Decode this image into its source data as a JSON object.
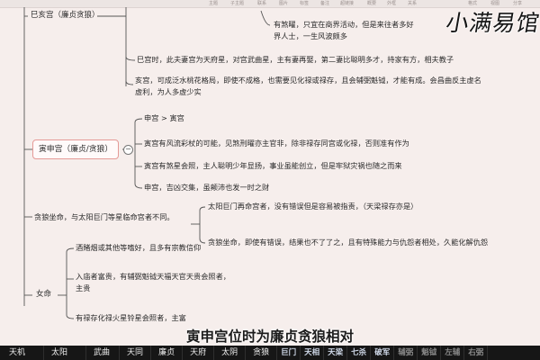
{
  "top_menu": [
    "主题",
    "子主题",
    "联系",
    "图片",
    "标签",
    "备注",
    "超链接",
    "概要",
    "外框",
    "关系",
    "格式",
    "视图",
    "分享"
  ],
  "watermark": "小满易馆",
  "mindmap": {
    "si_branch": {
      "title": "巳亥宫（廉贞贪狼）",
      "detail_top": [
        "有煞曜，只宜在商界活动，但是来往者多好",
        "界人士，一生风波颇多"
      ],
      "si_palace": [
        "巳宫时，此夫妻宫为天府星，对宫武曲星，主有妻再娶，第二妻比聪明多才，持家有方，相夫教子"
      ],
      "hai_palace": [
        "亥宫，可成泛水桃花格局，即使不成格，也需要见化禄或禄存，且会辅弼魁钺，才能有成。会昌曲反主虚名",
        "虚利，为人多虚少实"
      ]
    },
    "yin_branch": {
      "title": "寅申宫（廉贞/贪狼）",
      "items": [
        "申宫 > 寅宫",
        "寅宫有风流彩杖的可能，见煞刑曜亦主官非，除非禄存同宫或化禄，否则准有作为",
        "寅宫有煞星会照，主人聪明少年显扬，事业虽能创立，但是牢狱灾祸也随之而来",
        "申宫，吉凶交集，虽颠沛也发一时之财"
      ]
    },
    "tanlang_branch": {
      "title": "贪狼坐命，与太阳巨门等星临命宫者不同。",
      "items": [
        "太阳巨门再命宫者，没有错误但是容易被指责，（天梁禄存亦是）",
        "贪狼坐命，即使有错误，结果也不了了之，且有特殊能力与仇怨者相处，久能化解仇怨"
      ]
    },
    "female_branch": {
      "title": "女命",
      "items": [
        [
          "酒賭烟或其他等嗜好，且多有宗教信仰"
        ],
        [
          "入庙者富贵，有辅弼魁钺天福天官天贵会照者，",
          "主贵"
        ],
        [
          "有禄存化禄火星铃星会照者，主富"
        ]
      ]
    }
  },
  "subtitle": "寅申宫位时为廉贞贪狼相对",
  "star_bar": [
    "天机",
    "太阳",
    "武曲",
    "天同",
    "廉贞",
    "天府",
    "太阴",
    "贪狼",
    "巨门",
    "天相",
    "天梁",
    "七杀",
    "破军",
    "辅弼",
    "魁钺",
    "左辅",
    "右弼"
  ]
}
